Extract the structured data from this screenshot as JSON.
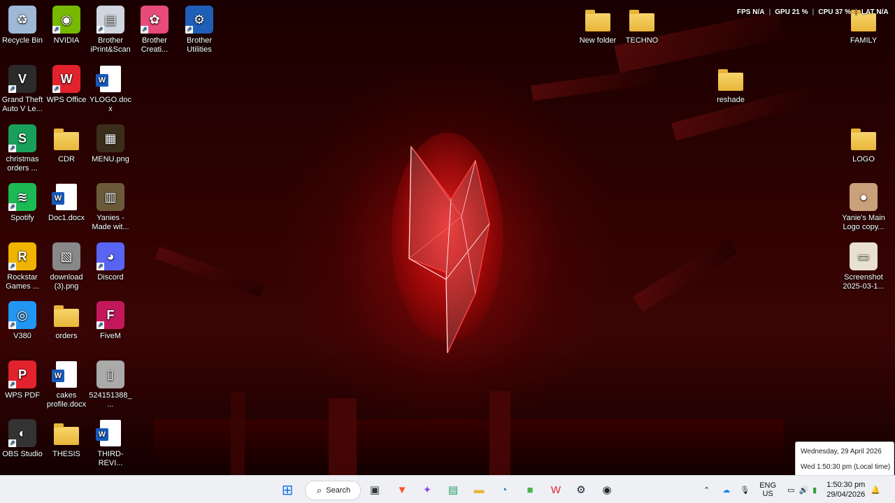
{
  "desktop": {
    "icons": [
      {
        "name": "recycle-bin",
        "label": "Recycle Bin",
        "glyph": "♻",
        "color": "#9fb8d6",
        "kind": "app"
      },
      {
        "name": "nvidia",
        "label": "NVIDIA",
        "glyph": "◉",
        "color": "#76b900",
        "kind": "app"
      },
      {
        "name": "brother-iprint-scan",
        "label": "Brother iPrint&Scan",
        "glyph": "▤",
        "color": "#cfd6e0",
        "kind": "app"
      },
      {
        "name": "brother-creative",
        "label": "Brother Creati...",
        "glyph": "✿",
        "color": "#e84a7a",
        "kind": "app"
      },
      {
        "name": "brother-utilities",
        "label": "Brother Utilities",
        "glyph": "⚙",
        "color": "#1e5fb8",
        "kind": "app"
      },
      {
        "name": "gta-v",
        "label": "Grand Theft Auto V Le...",
        "glyph": "V",
        "color": "#2b2b2b",
        "kind": "app"
      },
      {
        "name": "wps-office",
        "label": "WPS Office",
        "glyph": "W",
        "color": "#e2222d",
        "kind": "app"
      },
      {
        "name": "ylogo-docx",
        "label": "YLOGO.docx",
        "glyph": "W",
        "color": "#185abd",
        "kind": "doc"
      },
      {
        "name": "christmas-orders",
        "label": "christmas orders ...",
        "glyph": "S",
        "color": "#18a05a",
        "kind": "app"
      },
      {
        "name": "cdr-folder",
        "label": "CDR",
        "glyph": "",
        "color": "#e8b53a",
        "kind": "folder"
      },
      {
        "name": "menu-png",
        "label": "MENU.png",
        "glyph": "▦",
        "color": "#3a2e1a",
        "kind": "app"
      },
      {
        "name": "spotify",
        "label": "Spotify",
        "glyph": "≋",
        "color": "#1db954",
        "kind": "app"
      },
      {
        "name": "doc1-docx",
        "label": "Doc1.docx",
        "glyph": "W",
        "color": "#185abd",
        "kind": "doc"
      },
      {
        "name": "yanies-made-with",
        "label": "Yanies - Made wit...",
        "glyph": "▥",
        "color": "#6b5a3a",
        "kind": "app"
      },
      {
        "name": "rockstar-games",
        "label": "Rockstar Games ...",
        "glyph": "R",
        "color": "#f0b400",
        "kind": "app"
      },
      {
        "name": "download-3-png",
        "label": "download (3).png",
        "glyph": "▧",
        "color": "#888",
        "kind": "app"
      },
      {
        "name": "discord",
        "label": "Discord",
        "glyph": "◕",
        "color": "#5865f2",
        "kind": "app"
      },
      {
        "name": "v380",
        "label": "V380",
        "glyph": "◎",
        "color": "#2196f3",
        "kind": "app"
      },
      {
        "name": "orders-folder",
        "label": "orders",
        "glyph": "",
        "color": "#e8b53a",
        "kind": "folder"
      },
      {
        "name": "fivem",
        "label": "FiveM",
        "glyph": "F",
        "color": "#c2185b",
        "kind": "app"
      },
      {
        "name": "wps-pdf",
        "label": "WPS PDF",
        "glyph": "P",
        "color": "#e2222d",
        "kind": "app"
      },
      {
        "name": "cakes-profile-docx",
        "label": "cakes profile.docx",
        "glyph": "W",
        "color": "#185abd",
        "kind": "doc"
      },
      {
        "name": "file-524151388",
        "label": "524151388_...",
        "glyph": "▯",
        "color": "#aaa",
        "kind": "app"
      },
      {
        "name": "obs-studio",
        "label": "OBS Studio",
        "glyph": "◐",
        "color": "#333",
        "kind": "app"
      },
      {
        "name": "thesis-folder",
        "label": "THESIS",
        "glyph": "",
        "color": "#e8b53a",
        "kind": "folder"
      },
      {
        "name": "third-revi-docx",
        "label": "THIRD-REVI...",
        "glyph": "W",
        "color": "#185abd",
        "kind": "doc"
      },
      {
        "name": "new-folder",
        "label": "New folder",
        "glyph": "",
        "color": "#e8b53a",
        "kind": "folder"
      },
      {
        "name": "techno-folder",
        "label": "TECHNO",
        "glyph": "",
        "color": "#e8b53a",
        "kind": "folder"
      },
      {
        "name": "family-folder",
        "label": "FAMILY",
        "glyph": "",
        "color": "#e8b53a",
        "kind": "folder"
      },
      {
        "name": "reshade-folder",
        "label": "reshade",
        "glyph": "",
        "color": "#e8b53a",
        "kind": "folder"
      },
      {
        "name": "logo-folder",
        "label": "LOGO",
        "glyph": "",
        "color": "#e8b53a",
        "kind": "folder"
      },
      {
        "name": "yanies-main-logo",
        "label": "Yanie's Main Logo copy...",
        "glyph": "●",
        "color": "#c9a07a",
        "kind": "app"
      },
      {
        "name": "screenshot-2025",
        "label": "Screenshot 2025-03-1...",
        "glyph": "▭",
        "color": "#e8e0d0",
        "kind": "app"
      }
    ]
  },
  "overlay": {
    "fps_label": "FPS",
    "fps_value": "N/A",
    "gpu_label": "GPU",
    "gpu_value": "21 %",
    "cpu_label": "CPU",
    "cpu_value": "37 %",
    "lat_label": "LAT",
    "lat_value": "N/A"
  },
  "taskbar": {
    "search_label": "Search",
    "apps": [
      "start-icon",
      "task-view-icon",
      "brave-icon",
      "copilot-icon",
      "chat-icon",
      "file-explorer-icon",
      "edge-icon",
      "app-green-icon",
      "wps-icon",
      "steam-icon",
      "obs-icon"
    ],
    "lang_line1": "ENG",
    "lang_line2": "US",
    "time": "1:50:30 pm",
    "date": "29/04/2026"
  },
  "clock_popup": {
    "line1": "Wednesday, 29 April 2026",
    "line2": "Wed 1:50:30 pm (Local time)"
  }
}
